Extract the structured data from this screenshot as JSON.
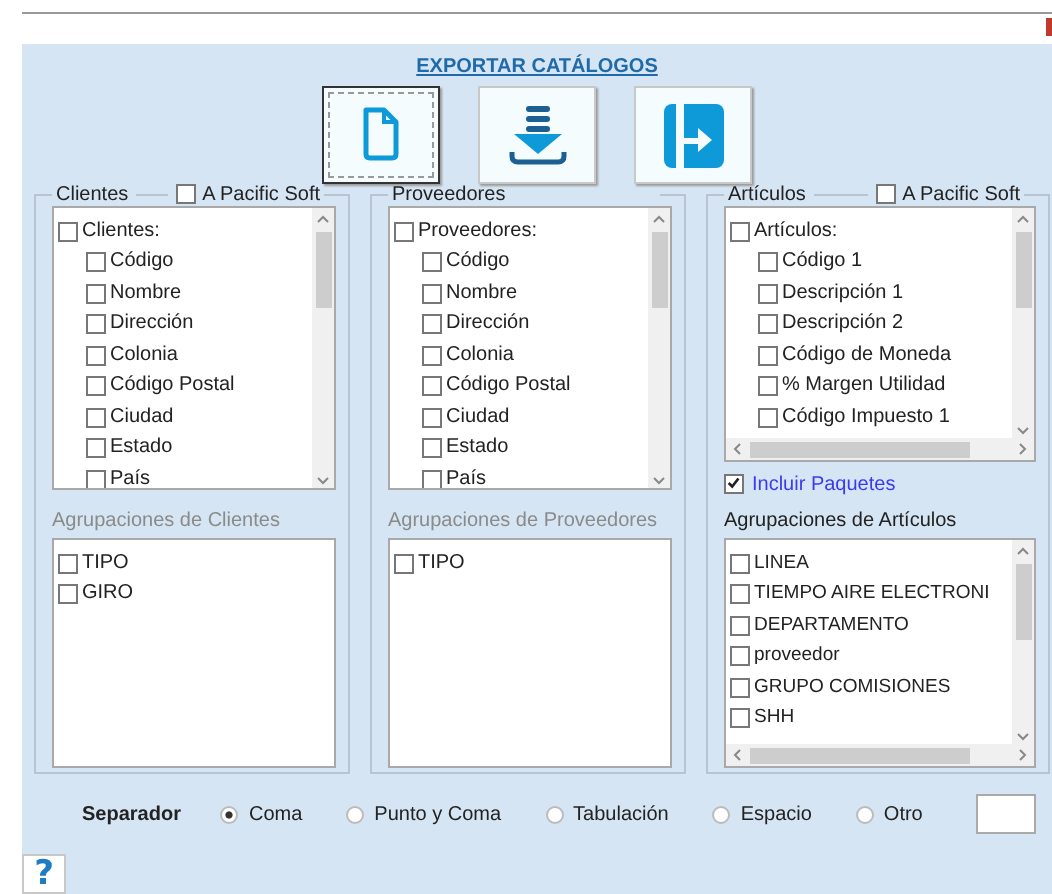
{
  "title": "EXPORTAR CATÁLOGOS",
  "toolbar": [
    {
      "kind": "document",
      "focused": true
    },
    {
      "kind": "download",
      "focused": false
    },
    {
      "kind": "exit",
      "focused": false
    }
  ],
  "groups": [
    {
      "title": "Clientes",
      "pacific_soft": {
        "label": "A Pacific Soft",
        "checked": false
      },
      "fields": [
        {
          "label": "Clientes:",
          "checked": false,
          "children": [
            {
              "label": "Código",
              "checked": false
            },
            {
              "label": "Nombre",
              "checked": false
            },
            {
              "label": "Dirección",
              "checked": false
            },
            {
              "label": "Colonia",
              "checked": false
            },
            {
              "label": "Código Postal",
              "checked": false
            },
            {
              "label": "Ciudad",
              "checked": false
            },
            {
              "label": "Estado",
              "checked": false
            },
            {
              "label": "País",
              "checked": false
            }
          ]
        }
      ],
      "groupings": {
        "title": "Agrupaciones de Clientes",
        "disabled": true,
        "items": [
          {
            "label": "TIPO",
            "checked": false
          },
          {
            "label": "GIRO",
            "checked": false
          }
        ]
      }
    },
    {
      "title": "Proveedores",
      "fields": [
        {
          "label": "Proveedores:",
          "checked": false,
          "children": [
            {
              "label": "Código",
              "checked": false
            },
            {
              "label": "Nombre",
              "checked": false
            },
            {
              "label": "Dirección",
              "checked": false
            },
            {
              "label": "Colonia",
              "checked": false
            },
            {
              "label": "Código Postal",
              "checked": false
            },
            {
              "label": "Ciudad",
              "checked": false
            },
            {
              "label": "Estado",
              "checked": false
            },
            {
              "label": "País",
              "checked": false
            }
          ]
        }
      ],
      "groupings": {
        "title": "Agrupaciones de Proveedores",
        "disabled": true,
        "items": [
          {
            "label": "TIPO",
            "checked": false
          }
        ]
      }
    },
    {
      "title": "Artículos",
      "pacific_soft": {
        "label": "A Pacific Soft",
        "checked": false
      },
      "fields": [
        {
          "label": "Artículos:",
          "checked": false,
          "children": [
            {
              "label": "Código 1",
              "checked": false
            },
            {
              "label": "Descripción 1",
              "checked": false
            },
            {
              "label": "Descripción 2",
              "checked": false
            },
            {
              "label": "Código de Moneda",
              "checked": false
            },
            {
              "label": "% Margen Utilidad",
              "checked": false
            },
            {
              "label": "Código Impuesto 1",
              "checked": false
            }
          ]
        }
      ],
      "include_packages": {
        "label": "Incluir Paquetes",
        "checked": true
      },
      "groupings": {
        "title": "Agrupaciones de Artículos",
        "disabled": false,
        "items": [
          {
            "label": "LINEA",
            "checked": false
          },
          {
            "label": "TIEMPO AIRE ELECTRONI",
            "checked": false
          },
          {
            "label": "DEPARTAMENTO",
            "checked": false
          },
          {
            "label": "proveedor",
            "checked": false
          },
          {
            "label": "GRUPO COMISIONES",
            "checked": false
          },
          {
            "label": "SHH",
            "checked": false
          }
        ]
      }
    }
  ],
  "separator": {
    "label": "Separador",
    "options": [
      {
        "label": "Coma",
        "selected": true
      },
      {
        "label": "Punto y Coma",
        "selected": false
      },
      {
        "label": "Tabulación",
        "selected": false
      },
      {
        "label": "Espacio",
        "selected": false
      },
      {
        "label": "Otro",
        "selected": false
      }
    ]
  },
  "help": "?"
}
